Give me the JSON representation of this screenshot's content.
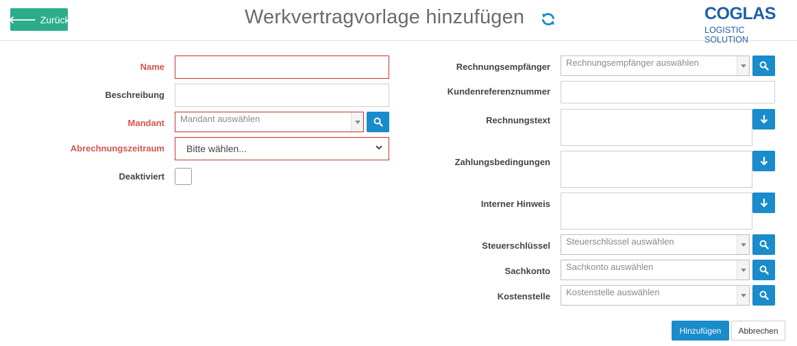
{
  "header": {
    "back_label": "Zurück",
    "title": "Werkvertragvorlage hinzufügen",
    "logo_main": "COGLAS",
    "logo_sub": "LOGISTIC SOLUTION"
  },
  "left_form": {
    "name_label": "Name",
    "beschreibung_label": "Beschreibung",
    "mandant_label": "Mandant",
    "mandant_placeholder": "Mandant auswählen",
    "abrechnung_label": "Abrechnungszeitraum",
    "abrechnung_value": "Bitte wählen...",
    "deaktiviert_label": "Deaktiviert"
  },
  "right_form": {
    "rechnungsempfaenger_label": "Rechnungsempfänger",
    "rechnungsempfaenger_placeholder": "Rechnungsempfänger auswählen",
    "kundenreferenz_label": "Kundenreferenznummer",
    "rechnungstext_label": "Rechnungstext",
    "zahlungsbedingungen_label": "Zahlungsbedingungen",
    "interner_hinweis_label": "Interner Hinweis",
    "steuerschluessel_label": "Steuerschlüssel",
    "steuerschluessel_placeholder": "Steuerschlüssel auswählen",
    "sachkonto_label": "Sachkonto",
    "sachkonto_placeholder": "Sachkonto auswählen",
    "kostenstelle_label": "Kostenstelle",
    "kostenstelle_placeholder": "Kostenstelle auswählen"
  },
  "footer": {
    "submit_label": "Hinzufügen",
    "cancel_label": "Abbrechen"
  },
  "colors": {
    "primary": "#1a8bcb",
    "success": "#2bad8c",
    "required": "#d9534f",
    "logo": "#1f5fa8"
  }
}
